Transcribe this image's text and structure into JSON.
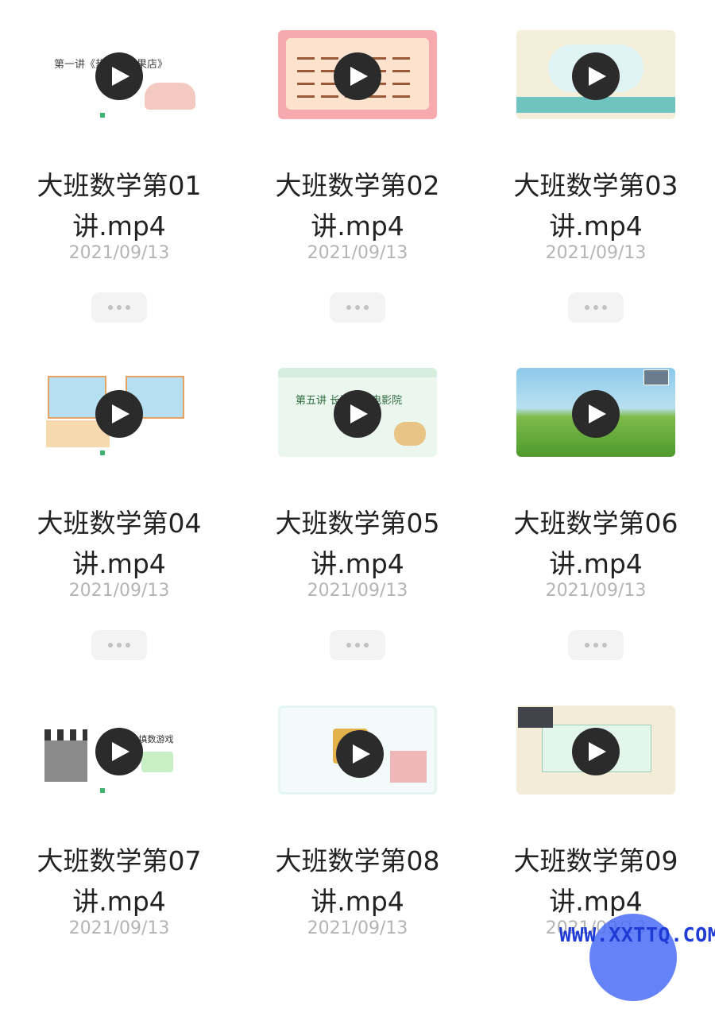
{
  "videos": [
    {
      "name_line1": "大班数学第01",
      "name_line2": "讲.mp4",
      "date": "2021/09/13",
      "thumb_title": "第一讲《热闹的糖果店》"
    },
    {
      "name_line1": "大班数学第02",
      "name_line2": "讲.mp4",
      "date": "2021/09/13",
      "thumb_title": ""
    },
    {
      "name_line1": "大班数学第03",
      "name_line2": "讲.mp4",
      "date": "2021/09/13",
      "thumb_title": ""
    },
    {
      "name_line1": "大班数学第04",
      "name_line2": "讲.mp4",
      "date": "2021/09/13",
      "thumb_title": ""
    },
    {
      "name_line1": "大班数学第05",
      "name_line2": "讲.mp4",
      "date": "2021/09/13",
      "thumb_title": "第五讲 长颈鹿的电影院"
    },
    {
      "name_line1": "大班数学第06",
      "name_line2": "讲.mp4",
      "date": "2021/09/13",
      "thumb_title": ""
    },
    {
      "name_line1": "大班数学第07",
      "name_line2": "讲.mp4",
      "date": "2021/09/13",
      "thumb_title": "第7讲 填数游戏"
    },
    {
      "name_line1": "大班数学第08",
      "name_line2": "讲.mp4",
      "date": "2021/09/13",
      "thumb_title": ""
    },
    {
      "name_line1": "大班数学第09",
      "name_line2": "讲.mp4",
      "date": "2021/09/13",
      "thumb_title": ""
    }
  ],
  "watermark": "WWW.XXTTQ.COM",
  "icons": {
    "play": "play-icon",
    "more": "more-dots-icon"
  },
  "colors": {
    "play_bg": "#2b2b2b",
    "date": "#b4b4b4",
    "more_bg": "#f3f3f3",
    "watermark": "#1f3bd6"
  }
}
